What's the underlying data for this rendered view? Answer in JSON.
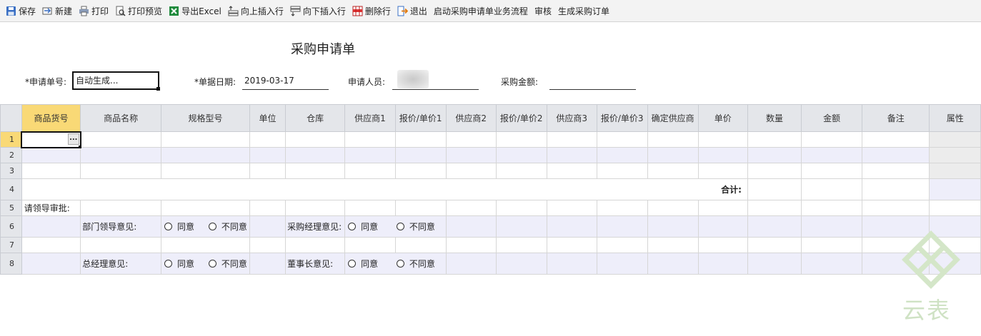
{
  "toolbar": {
    "items": [
      {
        "label": "保存",
        "icon": "save-icon"
      },
      {
        "label": "新建",
        "icon": "new-icon"
      },
      {
        "label": "打印",
        "icon": "print-icon"
      },
      {
        "label": "打印预览",
        "icon": "print-preview-icon"
      },
      {
        "label": "导出Excel",
        "icon": "excel-icon"
      },
      {
        "label": "向上插入行",
        "icon": "insert-row-above-icon"
      },
      {
        "label": "向下插入行",
        "icon": "insert-row-below-icon"
      },
      {
        "label": "删除行",
        "icon": "delete-row-icon"
      },
      {
        "label": "退出",
        "icon": "exit-icon"
      },
      {
        "label": "启动采购申请单业务流程"
      },
      {
        "label": "审核"
      },
      {
        "label": "生成采购订单"
      }
    ]
  },
  "form": {
    "title": "采购申请单",
    "request_no_label": "*申请单号:",
    "request_no_value": "自动生成...",
    "date_label": "*单据日期:",
    "date_value": "2019-03-17",
    "applicant_label": "申请人员:",
    "amount_label": "采购金额:"
  },
  "grid": {
    "columns": [
      "商品货号",
      "商品名称",
      "规格型号",
      "单位",
      "仓库",
      "供应商1",
      "报价/单价1",
      "供应商2",
      "报价/单价2",
      "供应商3",
      "报价/单价3",
      "确定供应商",
      "单价",
      "数量",
      "金额",
      "备注",
      "属性"
    ],
    "row_numbers": [
      "1",
      "2",
      "3",
      "4",
      "5",
      "6",
      "7",
      "8"
    ],
    "total_label": "合计:",
    "approval_label": "请领导审批:",
    "dept_leader_label": "部门领导意见:",
    "purchase_manager_label": "采购经理意见:",
    "general_manager_label": "总经理意见:",
    "chairman_label": "董事长意见:",
    "agree": "同意",
    "disagree": "不同意",
    "ellipsis": "..."
  },
  "watermark": {
    "brand": "云表",
    "color": "#cfe2c4"
  },
  "colors": {
    "selected_header": "#f9d976",
    "alt_row": "#eeeefa",
    "header_bg": "#e4e6ea"
  }
}
